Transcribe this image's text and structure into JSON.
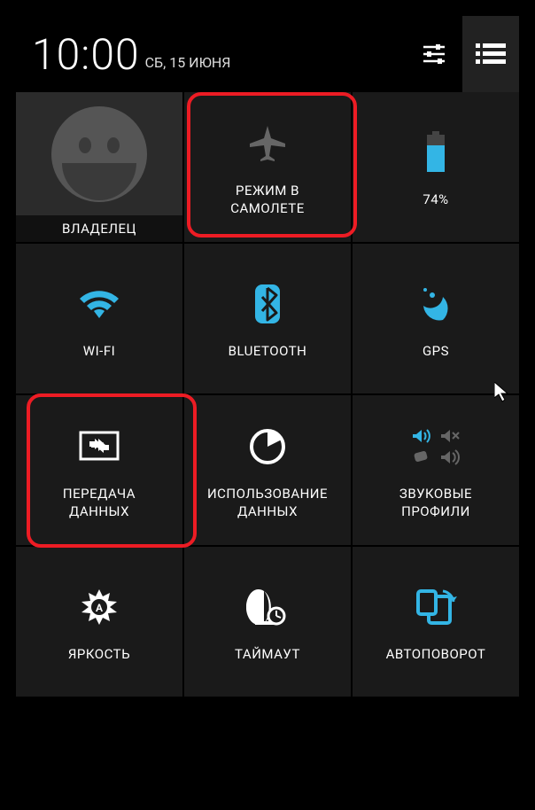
{
  "header": {
    "time": "10:00",
    "date": "СБ, 15 ИЮНЯ"
  },
  "tiles": {
    "owner": {
      "label": "ВЛАДЕЛЕЦ"
    },
    "airplane": {
      "label": "РЕЖИМ В\nСАМОЛЕТЕ"
    },
    "battery": {
      "label": "74%"
    },
    "wifi": {
      "label": "WI-FI"
    },
    "bluetooth": {
      "label": "BLUETOOTH"
    },
    "gps": {
      "label": "GPS"
    },
    "datatrans": {
      "label": "ПЕРЕДАЧА\nДАННЫХ"
    },
    "datausage": {
      "label": "ИСПОЛЬЗОВАНИЕ\nДАННЫХ"
    },
    "sound": {
      "label": "ЗВУКОВЫЕ\nПРОФИЛИ"
    },
    "brightness": {
      "label": "ЯРКОСТЬ"
    },
    "timeout": {
      "label": "ТАЙМАУТ"
    },
    "autorotate": {
      "label": "АВТОПОВОРОТ"
    }
  },
  "colors": {
    "accent": "#33b5e5",
    "inactive": "#666666",
    "highlight": "#ed1c24"
  }
}
